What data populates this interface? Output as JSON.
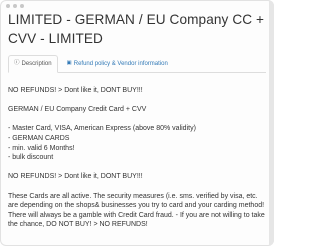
{
  "title": "LIMITED - GERMAN / EU Company CC + CVV - LIMITED",
  "tabs": [
    {
      "label": "Description",
      "icon": "info-circle-icon",
      "active": true
    },
    {
      "label": "Refund policy & Vendor information",
      "icon": "calendar-icon",
      "active": false
    }
  ],
  "description": {
    "line1": "NO REFUNDS! > Dont like it, DONT BUY!!!",
    "line2": "GERMAN / EU Company Credit Card + CVV",
    "bullets": [
      "- Master Card, VISA, American Express (above 80% validity)",
      "- GERMAN CARDS",
      "- min. valid 6 Months!",
      "- bulk discount"
    ],
    "line3": "NO REFUNDS! > Dont like it, DONT BUY!!!",
    "paragraph": "These Cards are all active. The security measures (i.e. sms. verified by visa, etc. are depending on the shops& businesses you try to card and your carding method! There will always be a gamble with Credit Card fraud. - If you are not willing to take the chance, DO NOT BUY! > NO REFUNDS!"
  },
  "colors": {
    "link": "#337ab7",
    "text": "#333333",
    "border": "#dddddd"
  }
}
